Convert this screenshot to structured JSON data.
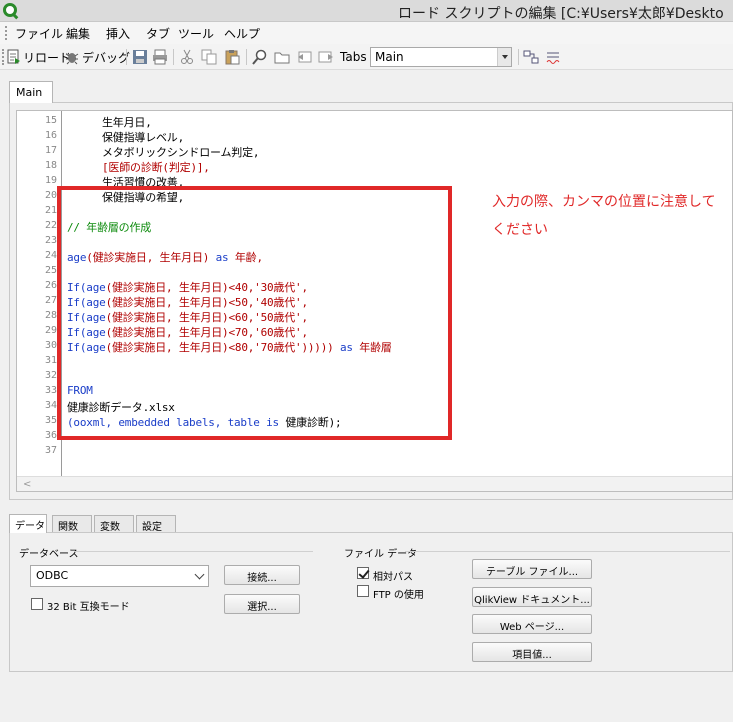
{
  "window": {
    "title": "ロード スクリプトの編集 [C:¥Users¥太郎¥Deskto"
  },
  "menu": [
    "ファイル",
    "編集",
    "挿入",
    "タブ",
    "ツール",
    "ヘルプ"
  ],
  "toolbar": {
    "reload_label": "リロード",
    "debug_label": "デバッグ",
    "tabs_label": "Tabs",
    "tabs_selected": "Main"
  },
  "editor": {
    "tab_label": "Main",
    "line_numbers": [
      "15",
      "16",
      "17",
      "18",
      "19",
      "20",
      "21",
      "22",
      "23",
      "24",
      "25",
      "26",
      "27",
      "28",
      "29",
      "30",
      "31",
      "32",
      "33",
      "34",
      "35",
      "36",
      "37"
    ],
    "lines": {
      "l15": "生年月日,",
      "l16": "保健指導レベル,",
      "l17": "メタボリックシンドローム判定,",
      "l18": "[医師の診断(判定)],",
      "l19": "生活習慣の改善,",
      "l20": "保健指導の希望,",
      "l22": "// 年齢層の作成",
      "l24a": "age",
      "l24b": "(健診実施日, 生年月日) ",
      "l24c": "as",
      "l24d": " 年齢,",
      "if_kw": "If",
      "age_kw": "age",
      "l26": "(健診実施日, 生年月日)<40,'30歳代',",
      "l27": "(健診実施日, 生年月日)<50,'40歳代',",
      "l28": "(健診実施日, 生年月日)<60,'50歳代',",
      "l29": "(健診実施日, 生年月日)<70,'60歳代',",
      "l30": "(健診実施日, 生年月日)<80,'70歳代'))))) ",
      "as_kw": "as",
      "l30end": " 年齢層",
      "l33": "FROM",
      "l34": "健康診断データ.xlsx",
      "l35a": "(ooxml, embedded labels, table is ",
      "l35b": "健康診断",
      "l35c": ");"
    }
  },
  "annotation": {
    "line1": "入力の際、カンマの位置に注意して",
    "line2": "ください"
  },
  "bottom_tabs": [
    "データ",
    "関数",
    "変数",
    "設定"
  ],
  "database": {
    "group_label": "データベース",
    "connection_value": "ODBC",
    "connect_button": "接続...",
    "select_button": "選択...",
    "compat_label": "32 Bit 互換モード"
  },
  "file_data": {
    "group_label": "ファイル データ",
    "relative_path_label": "相対パス",
    "relative_path_checked": true,
    "ftp_label": "FTP の使用",
    "ftp_checked": false,
    "table_file_button": "テーブル ファイル...",
    "qlikview_doc_button": "QlikView ドキュメント...",
    "web_page_button": "Web ページ...",
    "field_value_button": "項目値..."
  }
}
